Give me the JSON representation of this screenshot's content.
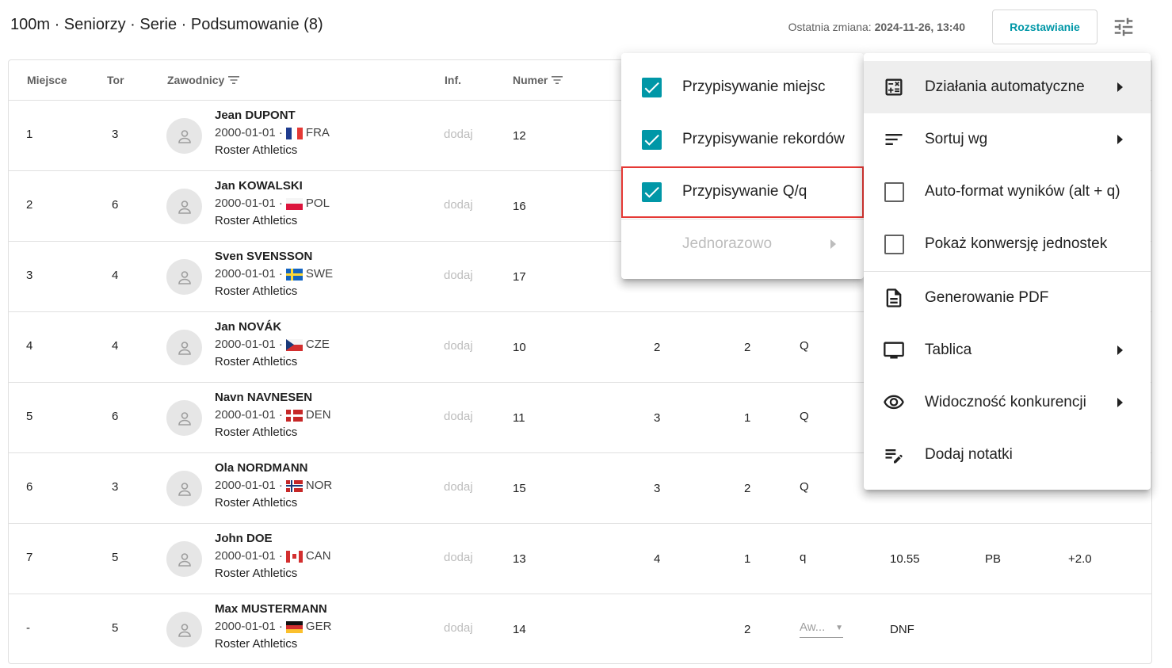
{
  "header": {
    "title": "100m · Seniorzy · Serie · Podsumowanie (8)",
    "last_change_label": "Ostatnia zmiana:",
    "last_change_value": "2024-11-26, 13:40",
    "seed_button": "Rozstawianie",
    "tune_icon": "tune-icon"
  },
  "table": {
    "headers": {
      "place": "Miejsce",
      "lane": "Tor",
      "athletes": "Zawodnicy",
      "info": "Inf.",
      "number": "Numer"
    },
    "rows": [
      {
        "place": "1",
        "lane": "3",
        "name": "Jean DUPONT",
        "dob": "2000-01-01 ·",
        "country": "FRA",
        "club": "Roster Athletics",
        "info": "dodaj",
        "number": "12",
        "heat": "",
        "pos": "",
        "q": "",
        "result": "",
        "rec": "",
        "wind": ""
      },
      {
        "place": "2",
        "lane": "6",
        "name": "Jan KOWALSKI",
        "dob": "2000-01-01 ·",
        "country": "POL",
        "club": "Roster Athletics",
        "info": "dodaj",
        "number": "16",
        "heat": "",
        "pos": "",
        "q": "",
        "result": "",
        "rec": "",
        "wind": ""
      },
      {
        "place": "3",
        "lane": "4",
        "name": "Sven SVENSSON",
        "dob": "2000-01-01 ·",
        "country": "SWE",
        "club": "Roster Athletics",
        "info": "dodaj",
        "number": "17",
        "heat": "",
        "pos": "",
        "q": "",
        "result": "",
        "rec": "",
        "wind": ""
      },
      {
        "place": "4",
        "lane": "4",
        "name": "Jan NOVÁK",
        "dob": "2000-01-01 ·",
        "country": "CZE",
        "club": "Roster Athletics",
        "info": "dodaj",
        "number": "10",
        "heat": "2",
        "pos": "2",
        "q": "Q",
        "result": "",
        "rec": "",
        "wind": ""
      },
      {
        "place": "5",
        "lane": "6",
        "name": "Navn NAVNESEN",
        "dob": "2000-01-01 ·",
        "country": "DEN",
        "club": "Roster Athletics",
        "info": "dodaj",
        "number": "11",
        "heat": "3",
        "pos": "1",
        "q": "Q",
        "result": "",
        "rec": "",
        "wind": ""
      },
      {
        "place": "6",
        "lane": "3",
        "name": "Ola NORDMANN",
        "dob": "2000-01-01 ·",
        "country": "NOR",
        "club": "Roster Athletics",
        "info": "dodaj",
        "number": "15",
        "heat": "3",
        "pos": "2",
        "q": "Q",
        "result": "",
        "rec": "",
        "wind": ""
      },
      {
        "place": "7",
        "lane": "5",
        "name": "John DOE",
        "dob": "2000-01-01 ·",
        "country": "CAN",
        "club": "Roster Athletics",
        "info": "dodaj",
        "number": "13",
        "heat": "4",
        "pos": "1",
        "q": "q",
        "result": "10.55",
        "rec": "PB",
        "wind": "+2.0"
      },
      {
        "place": "-",
        "lane": "5",
        "name": "Max MUSTERMANN",
        "dob": "2000-01-01 ·",
        "country": "GER",
        "club": "Roster Athletics",
        "info": "dodaj",
        "number": "14",
        "heat": "",
        "pos": "2",
        "q": "",
        "result": "DNF",
        "rec": "",
        "wind": "",
        "status_select": "Aw..."
      }
    ]
  },
  "menu_auto": {
    "items": [
      {
        "label": "Przypisywanie miejsc",
        "checked": true
      },
      {
        "label": "Przypisywanie rekordów",
        "checked": true
      },
      {
        "label": "Przypisywanie Q/q",
        "checked": true
      },
      {
        "label": "Jednorazowo",
        "disabled": true
      }
    ]
  },
  "menu_main": {
    "items": [
      {
        "label": "Działania automatyczne",
        "icon": "calculator-icon"
      },
      {
        "label": "Sortuj wg",
        "icon": "sort-icon"
      },
      {
        "label": "Auto-format wyników (alt + q)",
        "icon": "checkbox-empty-icon"
      },
      {
        "label": "Pokaż konwersję jednostek",
        "icon": "checkbox-empty-icon"
      },
      {
        "label": "Generowanie PDF",
        "icon": "document-icon"
      },
      {
        "label": "Tablica",
        "icon": "monitor-icon"
      },
      {
        "label": "Widoczność konkurencji",
        "icon": "eye-icon"
      },
      {
        "label": "Dodaj notatki",
        "icon": "edit-notes-icon"
      }
    ]
  },
  "colors": {
    "accent": "#0097a7",
    "highlight": "#e53935"
  }
}
